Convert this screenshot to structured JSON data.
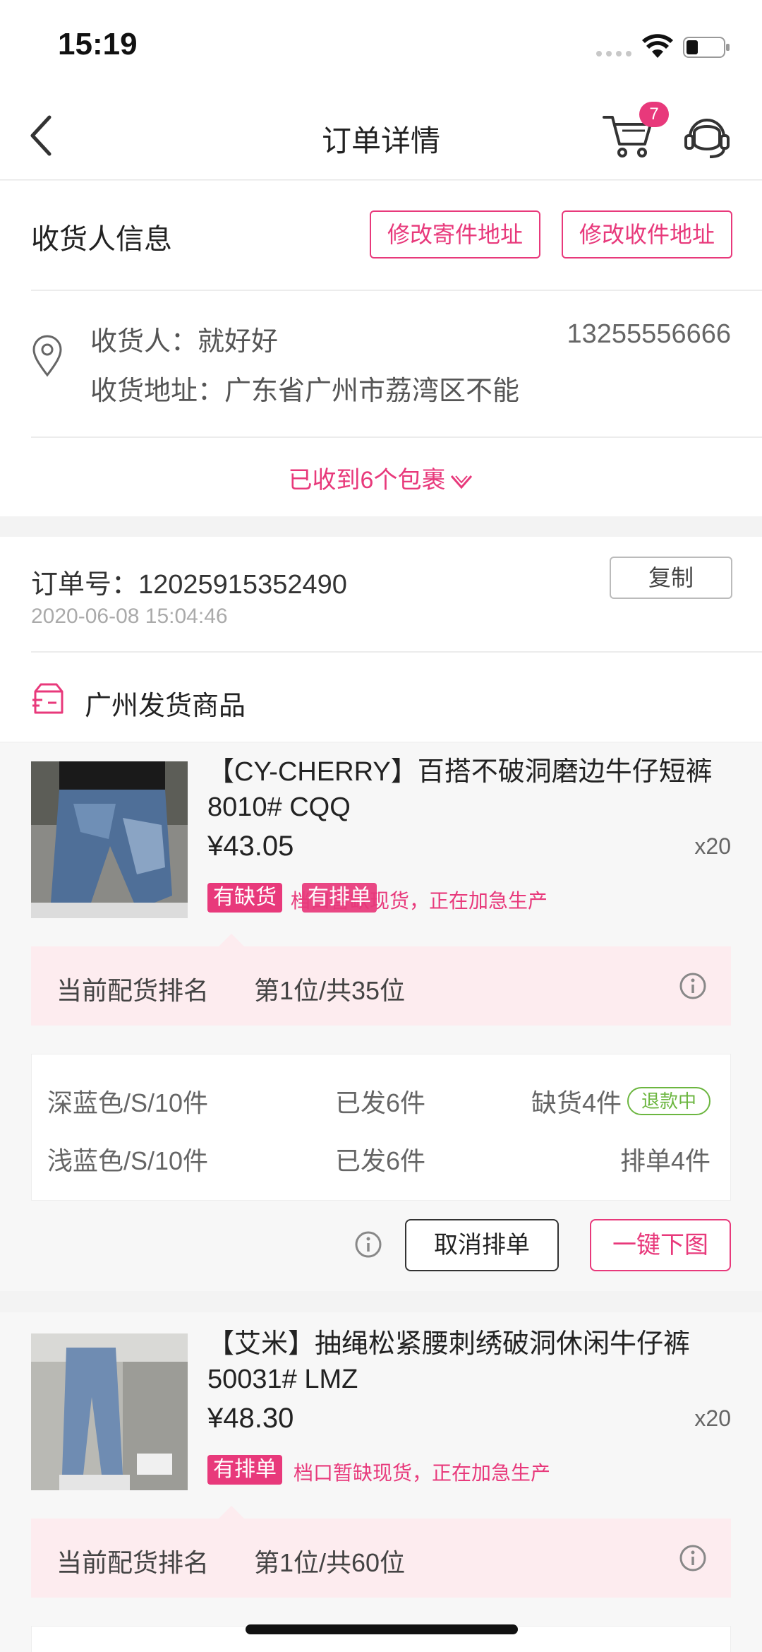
{
  "status": {
    "time": "15:19"
  },
  "nav": {
    "title": "订单详情",
    "cart_count": "7"
  },
  "receiver": {
    "section_title": "收货人信息",
    "edit_sender_btn": "修改寄件地址",
    "edit_receiver_btn": "修改收件地址",
    "name_line": "收货人：就好好",
    "phone": "13255556666",
    "address_line": "收货地址：广东省广州市荔湾区不能",
    "parcels_text": "已收到6个包裹"
  },
  "order": {
    "number_line": "订单号：12025915352490",
    "time": "2020-06-08 15:04:46",
    "copy_btn": "复制",
    "ship_title": "广州发货商品"
  },
  "products": [
    {
      "title": "【CY-CHERRY】百搭不破洞磨边牛仔短裤 8010# CQQ",
      "price": "¥43.05",
      "qty": "x20",
      "tag1": "有缺货",
      "tag2": "有排单",
      "note": "档口暂缺现货，正在加急生产",
      "rank_label": "当前配货排名",
      "rank_value": "第1位/共35位",
      "skus": [
        {
          "spec": "深蓝色/S/10件",
          "shipped": "已发6件",
          "status": "缺货4件",
          "pill": "退款中"
        },
        {
          "spec": "浅蓝色/S/10件",
          "shipped": "已发6件",
          "status": "排单4件"
        }
      ],
      "cancel_btn": "取消排单",
      "download_btn": "一键下图"
    },
    {
      "title": "【艾米】抽绳松紧腰刺绣破洞休闲牛仔裤 50031# LMZ",
      "price": "¥48.30",
      "qty": "x20",
      "tag1": "有排单",
      "note": "档口暂缺现货，正在加急生产",
      "rank_label": "当前配货排名",
      "rank_value": "第1位/共60位"
    }
  ],
  "colors": {
    "accent": "#e8397b",
    "refund_green": "#6cb640",
    "rank_bg": "#fdecef"
  },
  "icons": [
    "back-icon",
    "cart-icon",
    "customer-service-icon",
    "location-pin-icon",
    "chevron-down-icon",
    "shipping-box-icon",
    "info-icon",
    "wifi-icon",
    "battery-icon"
  ]
}
